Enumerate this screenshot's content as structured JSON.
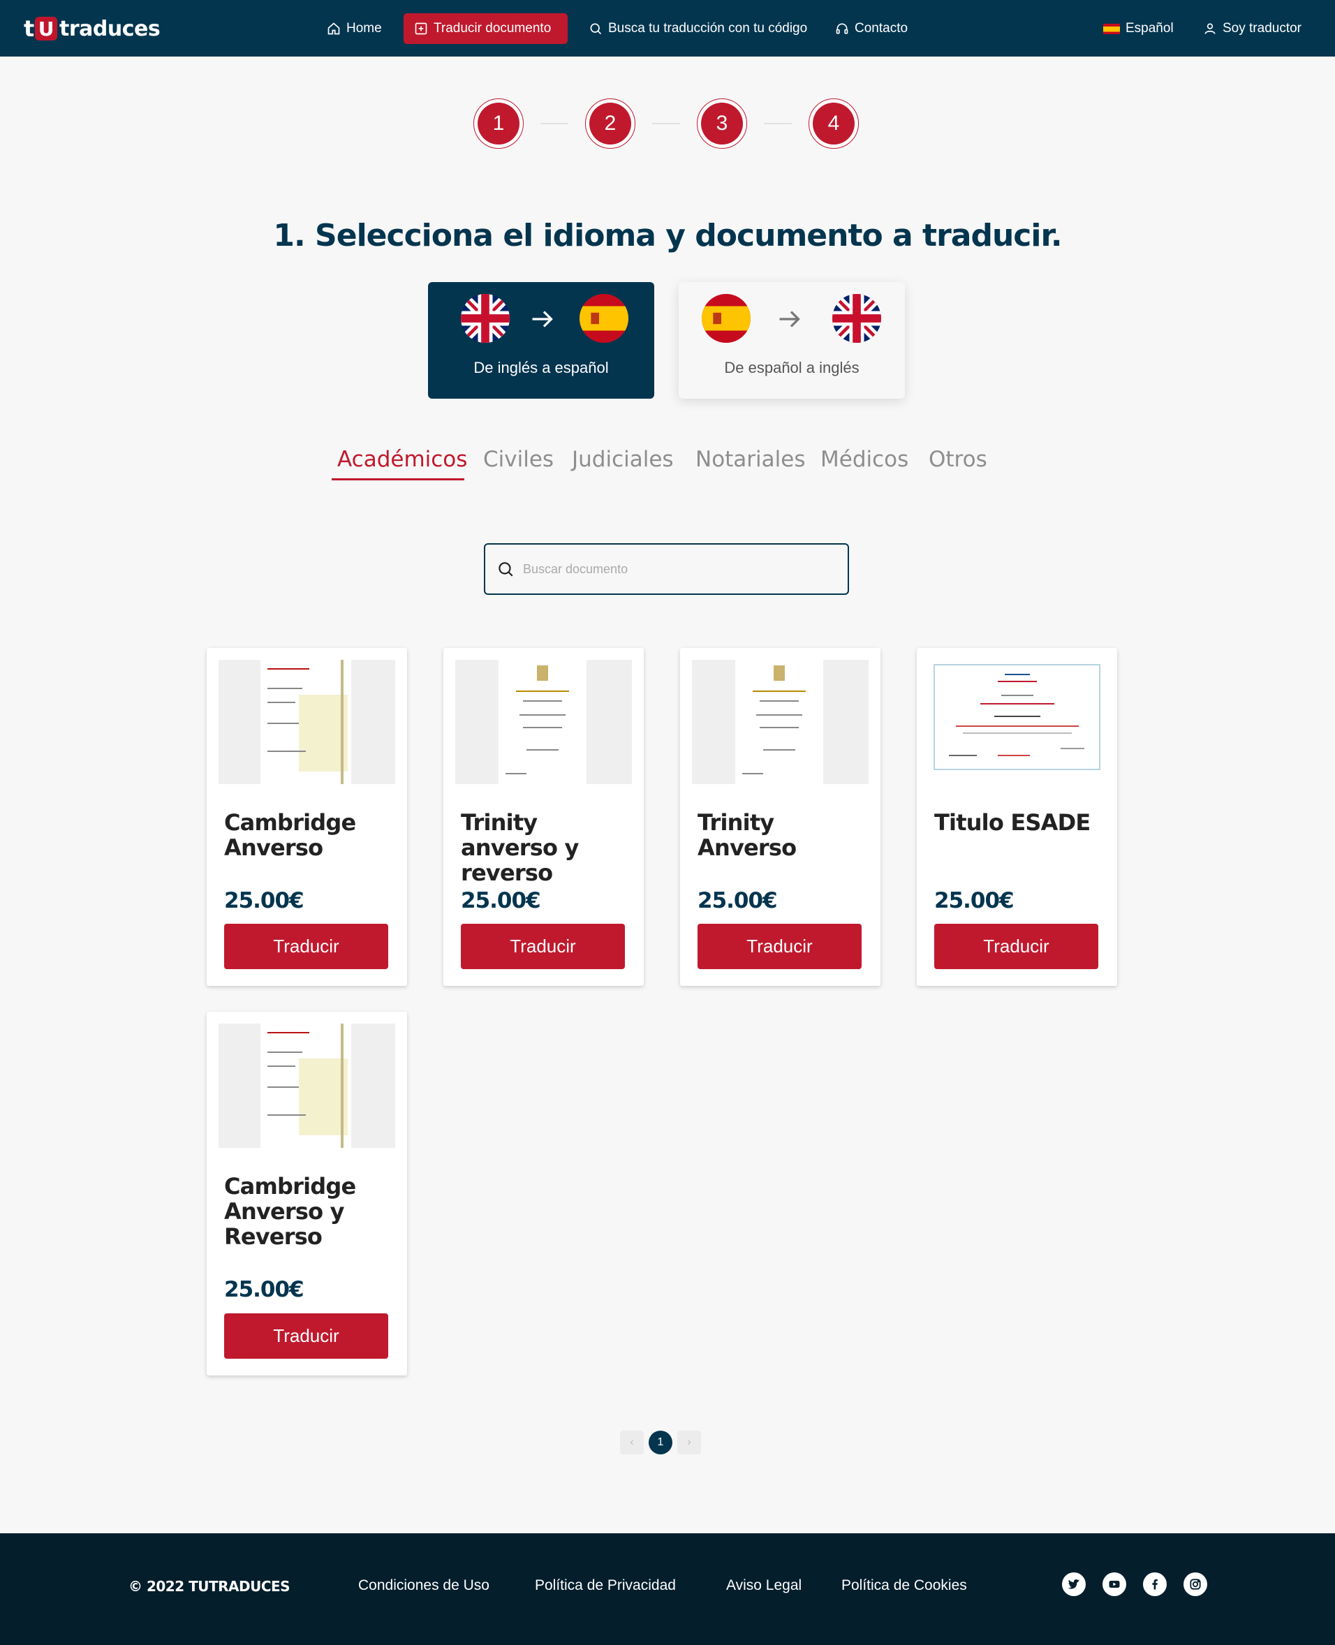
{
  "nav": {
    "logo_t": "t",
    "logo_u": "U",
    "logo_rest": "traduces",
    "home": "Home",
    "traducir": "Traducir documento",
    "busca": "Busca tu traducción con tu código",
    "contacto": "Contacto",
    "language": "Español",
    "translator": "Soy traductor",
    "icons": [
      "home-icon",
      "file-plus-icon",
      "search-icon",
      "headset-icon",
      "spain-flag-icon",
      "user-icon"
    ]
  },
  "steps": [
    "1",
    "2",
    "3",
    "4"
  ],
  "title": "1. Selecciona el idioma y documento a traducir.",
  "language_pairs": [
    {
      "label": "De inglés a español",
      "from": "uk-flag",
      "to": "spain-flag",
      "selected": true
    },
    {
      "label": "De español a inglés",
      "from": "spain-flag",
      "to": "uk-flag",
      "selected": false
    }
  ],
  "tabs": [
    "Académicos",
    "Civiles",
    "Judiciales",
    "Notariales",
    "Médicos",
    "Otros"
  ],
  "active_tab": "Académicos",
  "search": {
    "placeholder": "Buscar documento",
    "value": ""
  },
  "products": [
    {
      "name": "Cambridge Anverso",
      "price": "25.00€",
      "button": "Traducir"
    },
    {
      "name": "Trinity anverso y reverso",
      "price": "25.00€",
      "button": "Traducir"
    },
    {
      "name": "Trinity Anverso",
      "price": "25.00€",
      "button": "Traducir"
    },
    {
      "name": "Titulo ESADE",
      "price": "25.00€",
      "button": "Traducir"
    },
    {
      "name": "Cambridge Anverso y Reverso",
      "price": "25.00€",
      "button": "Traducir"
    }
  ],
  "pagination": {
    "prev": "‹",
    "current": "1",
    "next": "›"
  },
  "footer": {
    "copyright": "© 2022 TUTRADUCES",
    "links": [
      "Condiciones de Uso",
      "Política de Privacidad",
      "Aviso Legal",
      "Política de Cookies"
    ],
    "social": [
      "twitter-icon",
      "youtube-icon",
      "facebook-icon",
      "instagram-icon"
    ]
  },
  "colors": {
    "navy": "#04354f",
    "red": "#c0192d",
    "footer": "#041e2c",
    "background": "#f7f7f7"
  }
}
